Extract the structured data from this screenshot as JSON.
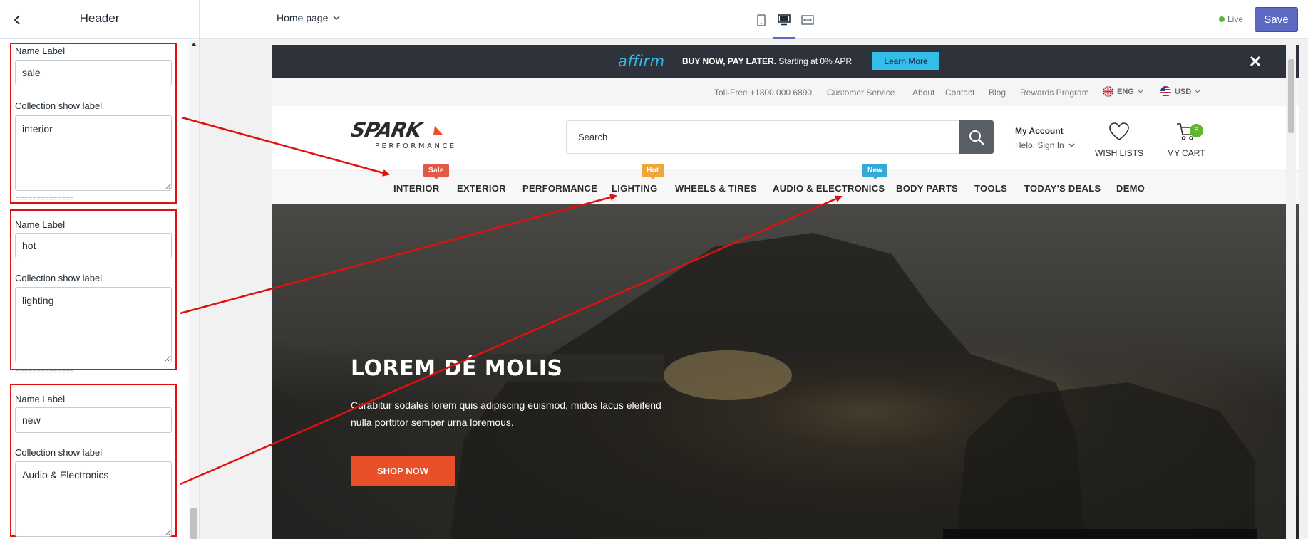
{
  "sidebar": {
    "title": "Header",
    "groups": [
      {
        "name_label_title": "Name Label",
        "name_label_value": "sale",
        "collection_title": "Collection show label",
        "collection_value": "interior"
      },
      {
        "name_label_title": "Name Label",
        "name_label_value": "hot",
        "collection_title": "Collection show label",
        "collection_value": "lighting"
      },
      {
        "name_label_title": "Name Label",
        "name_label_value": "new",
        "collection_title": "Collection show label",
        "collection_value": "Audio & Electronics"
      }
    ],
    "separator": "=============="
  },
  "topbar": {
    "page_select": "Home page",
    "live_label": "Live",
    "save_label": "Save",
    "accent_color": "#5c6ac4"
  },
  "preview": {
    "promo": {
      "brand": "affirm",
      "headline": "BUY NOW, PAY LATER.",
      "subtext": "Starting at 0% APR",
      "button": "Learn More"
    },
    "utility": {
      "phone": "Toll-Free +1800 000 6890",
      "links": [
        "Customer Service",
        "About",
        "Contact",
        "Blog",
        "Rewards Program"
      ],
      "language": "ENG",
      "currency": "USD"
    },
    "logo": {
      "main": "SPARK",
      "sub": "PERFORMANCE"
    },
    "search": {
      "placeholder": "Search"
    },
    "account": {
      "title": "My Account",
      "subtitle": "Helo. Sign In"
    },
    "wishlist_label": "WISH LISTS",
    "cart_label": "MY CART",
    "cart_count": "8",
    "nav": {
      "items": [
        "INTERIOR",
        "EXTERIOR",
        "PERFORMANCE",
        "LIGHTING",
        "WHEELS & TIRES",
        "AUDIO & ELECTRONICS",
        "BODY PARTS",
        "TOOLS",
        "TODAY'S DEALS",
        "DEMO"
      ],
      "badges": {
        "sale": {
          "text": "Sale",
          "color": "#e05a47"
        },
        "hot": {
          "text": "Hot",
          "color": "#f2a53a"
        },
        "new": {
          "text": "New",
          "color": "#34a8d6"
        }
      }
    },
    "hero": {
      "title": "LOREM DÉ MOLIS",
      "text": "Curabitur sodales lorem quis adipiscing euismod, midos lacus eleifend nulla porttitor semper urna loremous.",
      "button": "SHOP NOW",
      "button_color": "#e8502a"
    }
  },
  "annotation_color": "#e01010"
}
